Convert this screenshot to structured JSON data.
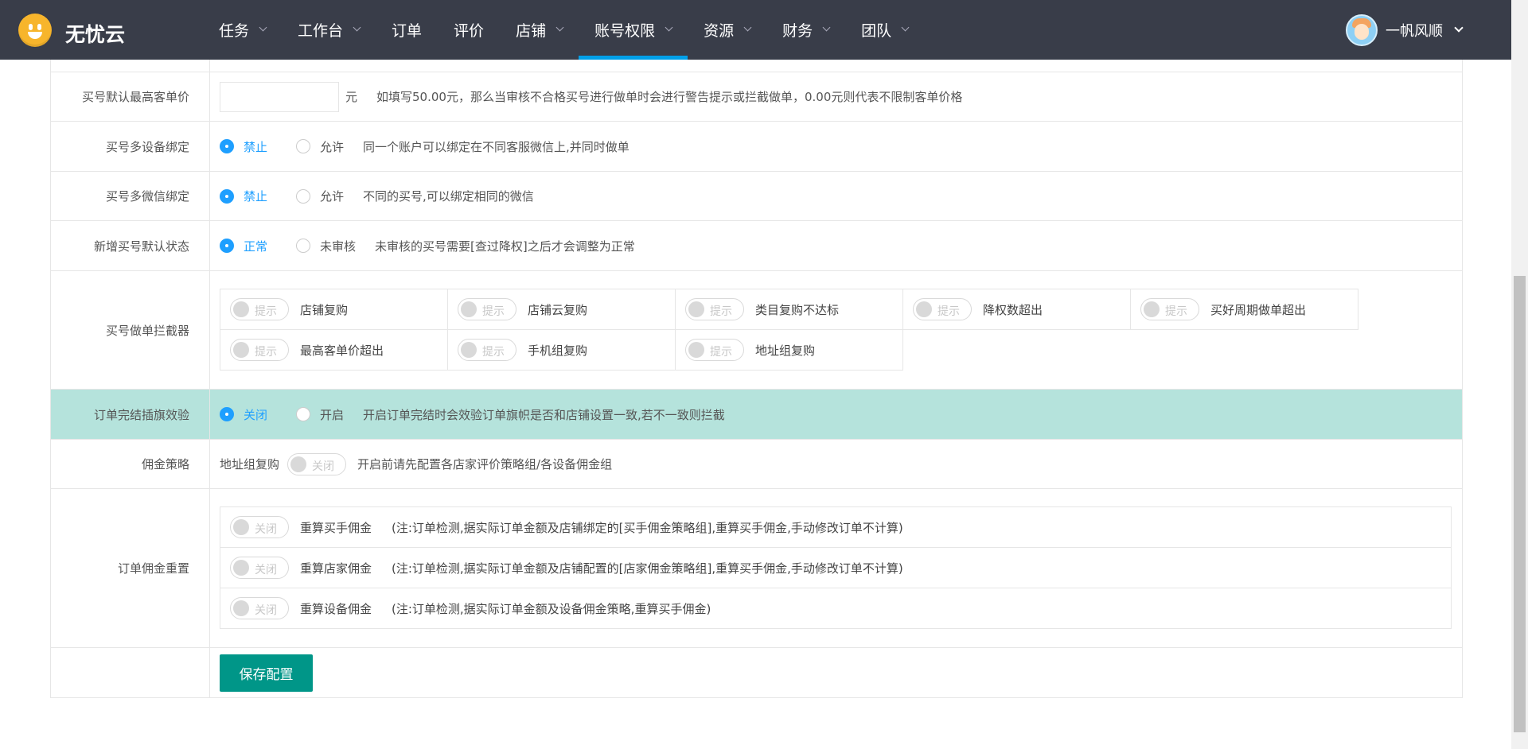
{
  "brand": {
    "name": "无忧云"
  },
  "nav": {
    "items": [
      "任务",
      "工作台",
      "订单",
      "评价",
      "店铺",
      "账号权限",
      "资源",
      "财务",
      "团队"
    ],
    "active": "账号权限"
  },
  "user": {
    "name": "一帆风顺"
  },
  "form": {
    "max_price": {
      "label": "买号默认最高客单价",
      "unit": "元",
      "hint": "如填写50.00元，那么当审核不合格买号进行做单时会进行警告提示或拦截做单，0.00元则代表不限制客单价格"
    },
    "multi_device": {
      "label": "买号多设备绑定",
      "opt1": "禁止",
      "opt2": "允许",
      "hint": "同一个账户可以绑定在不同客服微信上,并同时做单"
    },
    "multi_wechat": {
      "label": "买号多微信绑定",
      "opt1": "禁止",
      "opt2": "允许",
      "hint": "不同的买号,可以绑定相同的微信"
    },
    "default_status": {
      "label": "新增买号默认状态",
      "opt1": "正常",
      "opt2": "未审核",
      "hint": "未审核的买号需要[查过降权]之后才会调整为正常"
    },
    "interceptor": {
      "label": "买号做单拦截器",
      "switch_text": "提示",
      "items": [
        "店铺复购",
        "店铺云复购",
        "类目复购不达标",
        "降权数超出",
        "买好周期做单超出",
        "最高客单价超出",
        "手机组复购",
        "地址组复购"
      ]
    },
    "flag_check": {
      "label": "订单完结插旗效验",
      "opt1": "关闭",
      "opt2": "开启",
      "hint": "开启订单完结时会效验订单旗帜是否和店铺设置一致,若不一致则拦截"
    },
    "commission": {
      "label": "佣金策略",
      "prefix": "地址组复购",
      "switch_text": "关闭",
      "hint": "开启前请先配置各店家评价策略组/各设备佣金组"
    },
    "reset": {
      "label": "订单佣金重置",
      "switch_text": "关闭",
      "items": [
        {
          "name": "重算买手佣金",
          "note": "(注:订单检测,据实际订单金额及店铺绑定的[买手佣金策略组],重算买手佣金,手动修改订单不计算)"
        },
        {
          "name": "重算店家佣金",
          "note": "(注:订单检测,据实际订单金额及店铺配置的[店家佣金策略组],重算买手佣金,手动修改订单不计算)"
        },
        {
          "name": "重算设备佣金",
          "note": "(注:订单检测,据实际订单金额及设备佣金策略,重算买手佣金)"
        }
      ]
    },
    "save_label": "保存配置"
  }
}
